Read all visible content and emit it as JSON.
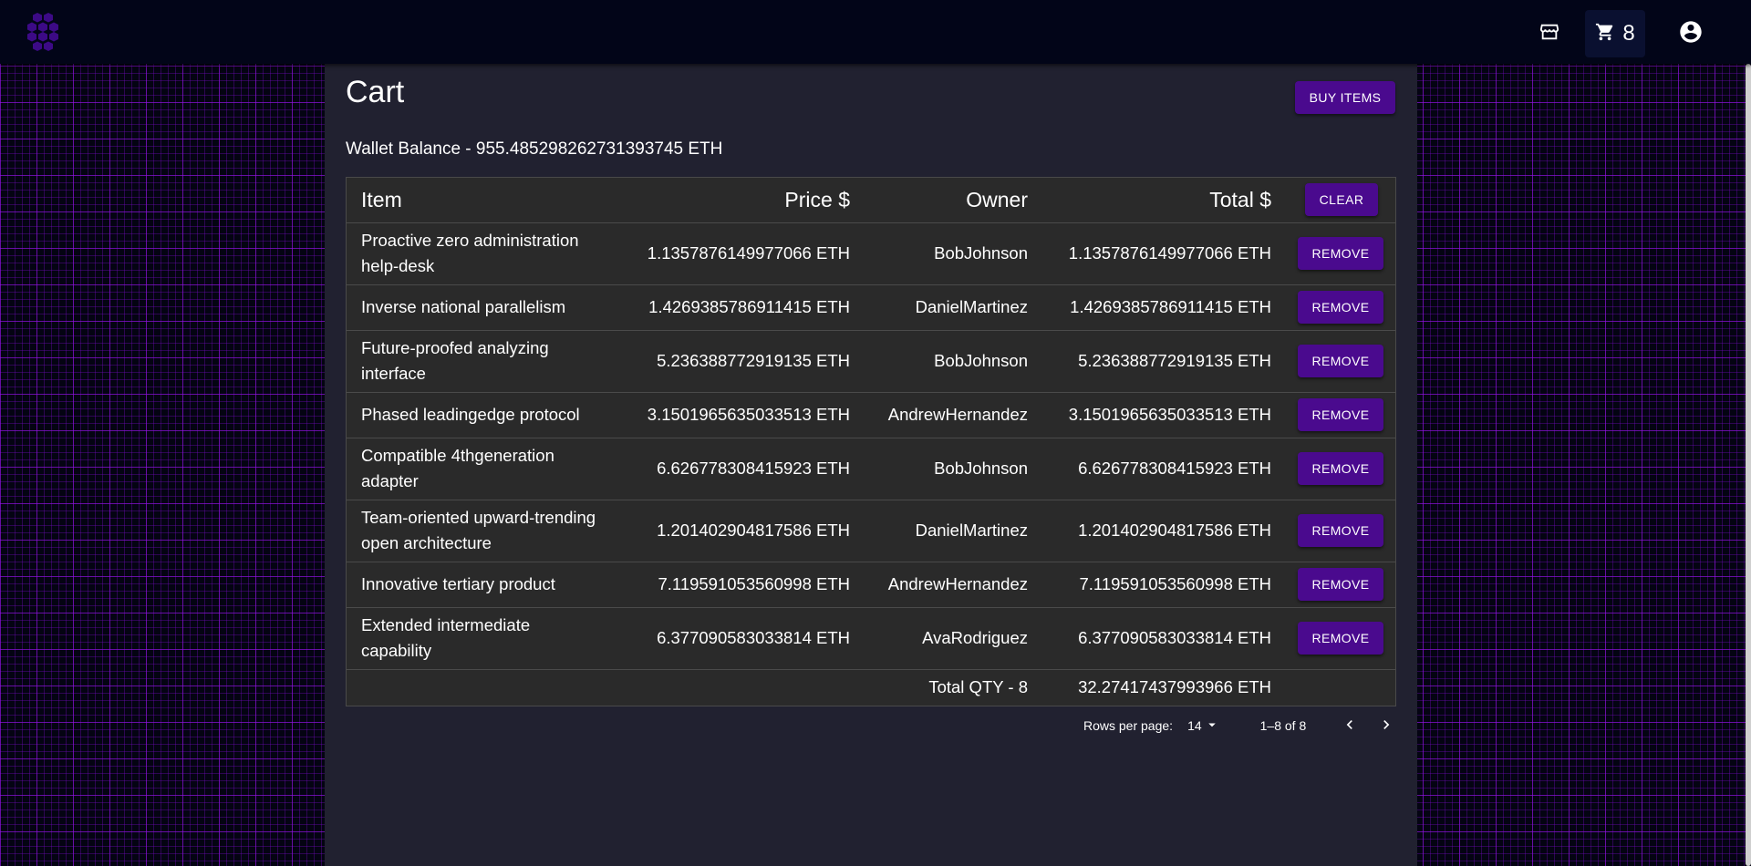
{
  "nav": {
    "logo_icon": "hexagon-cluster-logo",
    "store_icon": "storefront-icon",
    "cart_icon": "shopping-cart-icon",
    "cart_count": "8",
    "account_icon": "account-circle-icon"
  },
  "page": {
    "title": "Cart",
    "buy_label": "BUY ITEMS",
    "wallet_balance": "Wallet Balance - 955.485298262731393745 ETH"
  },
  "table": {
    "headers": {
      "item": "Item",
      "price": "Price $",
      "owner": "Owner",
      "total": "Total $",
      "clear_label": "CLEAR"
    },
    "remove_label": "REMOVE",
    "rows": [
      {
        "item": "Proactive zero administration help-desk",
        "price": "1.1357876149977066 ETH",
        "owner": "BobJohnson",
        "total": "1.1357876149977066 ETH"
      },
      {
        "item": "Inverse national parallelism",
        "price": "1.4269385786911415 ETH",
        "owner": "DanielMartinez",
        "total": "1.4269385786911415 ETH"
      },
      {
        "item": "Future-proofed analyzing interface",
        "price": "5.236388772919135 ETH",
        "owner": "BobJohnson",
        "total": "5.236388772919135 ETH"
      },
      {
        "item": "Phased leadingedge protocol",
        "price": "3.1501965635033513 ETH",
        "owner": "AndrewHernandez",
        "total": "3.1501965635033513 ETH"
      },
      {
        "item": "Compatible 4thgeneration adapter",
        "price": "6.626778308415923 ETH",
        "owner": "BobJohnson",
        "total": "6.626778308415923 ETH"
      },
      {
        "item": "Team-oriented upward-trending open architecture",
        "price": "1.201402904817586 ETH",
        "owner": "DanielMartinez",
        "total": "1.201402904817586 ETH"
      },
      {
        "item": "Innovative tertiary product",
        "price": "7.119591053560998 ETH",
        "owner": "AndrewHernandez",
        "total": "7.119591053560998 ETH"
      },
      {
        "item": "Extended intermediate capability",
        "price": "6.377090583033814 ETH",
        "owner": "AvaRodriguez",
        "total": "6.377090583033814 ETH"
      }
    ],
    "footer": {
      "total_qty": "Total QTY - 8",
      "grand_total": "32.27417437993966 ETH"
    }
  },
  "pagination": {
    "rows_label": "Rows per page:",
    "rows_value": "14",
    "range": "1–8 of 8",
    "prev_icon": "chevron-left-icon",
    "next_icon": "chevron-right-icon"
  },
  "colors": {
    "accent": "#4a0a8e",
    "appbar": "#020518",
    "panel": "#212130",
    "table": "#2a2a2a",
    "grid": "#9614e6"
  }
}
